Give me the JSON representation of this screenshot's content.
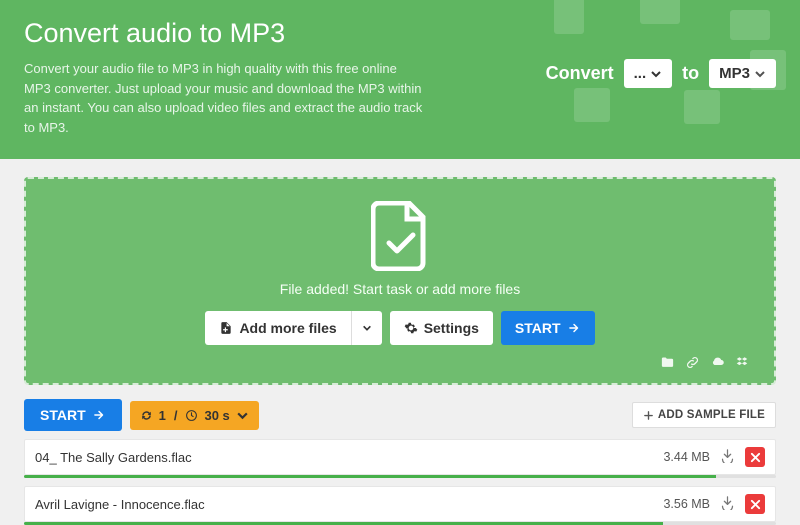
{
  "hero": {
    "title": "Convert audio to MP3",
    "description": "Convert your audio file to MP3 in high quality with this free online MP3 converter. Just upload your music and download the MP3 within an instant. You can also upload video files and extract the audio track to MP3.",
    "convert_label": "Convert",
    "to_label": "to",
    "from_value": "...",
    "to_value": "MP3"
  },
  "dropzone": {
    "message": "File added! Start task or add more files",
    "add_more": "Add more files",
    "settings": "Settings",
    "start": "START"
  },
  "controls": {
    "start": "START",
    "count": "1",
    "time": "30 s",
    "add_sample": "ADD SAMPLE FILE"
  },
  "files": [
    {
      "name": "04_ The Sally Gardens.flac",
      "size": "3.44 MB"
    },
    {
      "name": "Avril Lavigne - Innocence.flac",
      "size": "3.56 MB"
    }
  ]
}
